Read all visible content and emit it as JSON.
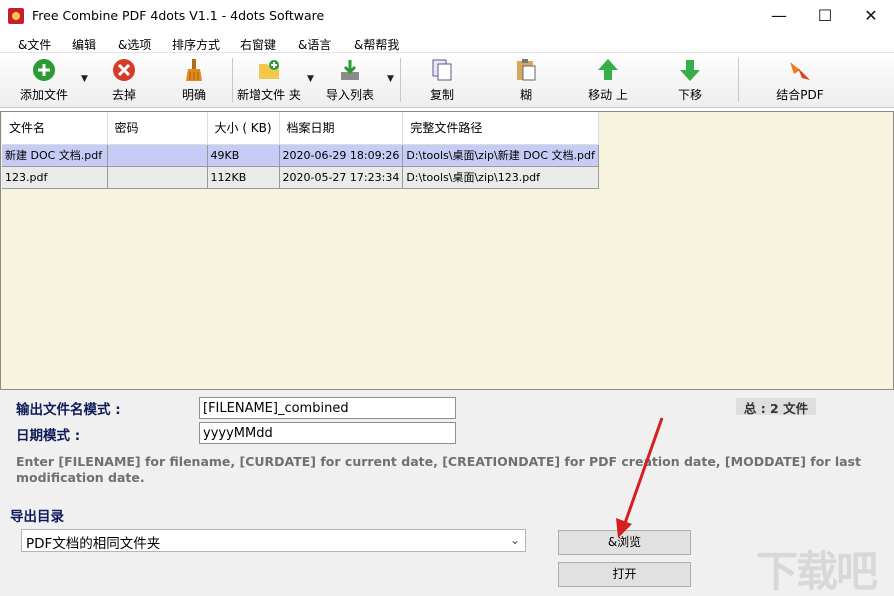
{
  "window": {
    "title": "Free Combine PDF 4dots V1.1 - 4dots Software",
    "minimize": "—",
    "maximize": "☐",
    "close": "✕"
  },
  "menu": [
    "&文件",
    "编辑",
    "&选项",
    "排序方式",
    "右窗键",
    "&语言",
    "&帮帮我"
  ],
  "toolbar": {
    "add_file": "添加文件",
    "remove": "去掉",
    "clear": "明确",
    "add_folder": "新增文件 夹",
    "import_list": "导入列表",
    "copy": "复制",
    "paste": "糊",
    "move_up": "移动 上",
    "move_down": "下移",
    "combine": "结合PDF",
    "dropdown_arrow": "▼"
  },
  "table": {
    "headers": [
      "文件名",
      "密码",
      "大小 ( KB)",
      "档案日期",
      "完整文件路径"
    ],
    "rows": [
      [
        "新建 DOC 文档.pdf",
        "",
        "49KB",
        "2020-06-29 18:09:26",
        "D:\\tools\\桌面\\zip\\新建 DOC 文档.pdf"
      ],
      [
        "123.pdf",
        "",
        "112KB",
        "2020-05-27 17:23:34",
        "D:\\tools\\桌面\\zip\\123.pdf"
      ]
    ]
  },
  "options": {
    "filename_pattern_label": "输出文件名模式 :",
    "filename_pattern_value": "[FILENAME]_combined",
    "date_pattern_label": "日期模式 :",
    "date_pattern_value": "yyyyMMdd",
    "total": "总 : 2 文件",
    "hint": "Enter [FILENAME] for filename, [CURDATE] for current date, [CREATIONDATE] for PDF creation date, [MODDATE] for last modification date.",
    "output_dir_label": "导出目录",
    "output_dir_value": "PDF文档的相同文件夹",
    "select_arrow": "⌄",
    "browse": "&浏览",
    "open": "打开",
    "watermark": "下载吧"
  },
  "colors": {
    "accent_label": "#0f1a5a",
    "list_bg": "#f8f3df",
    "selected_row": "#c6ccf6",
    "annotation_arrow": "#d42020"
  }
}
